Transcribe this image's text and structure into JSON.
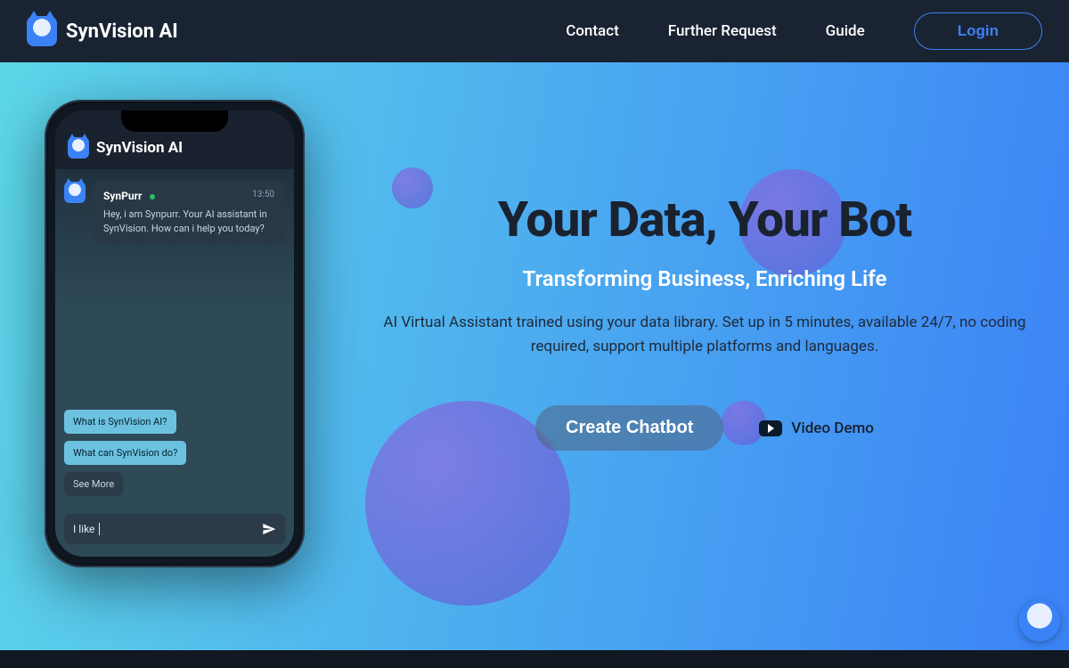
{
  "brand": {
    "name": "SynVision AI"
  },
  "nav": {
    "links": [
      "Contact",
      "Further Request",
      "Guide"
    ],
    "login": "Login"
  },
  "hero": {
    "headline": "Your Data, Your Bot",
    "subhead": "Transforming Business, Enriching Life",
    "body": "AI Virtual Assistant trained using your data library. Set up in 5 minutes, available 24/7, no coding required, support multiple platforms and languages.",
    "cta_primary": "Create Chatbot",
    "cta_secondary": "Video Demo"
  },
  "phone": {
    "app_title": "SynVision AI",
    "bot_name": "SynPurr",
    "time": "13:50",
    "greeting": "Hey, i am Synpurr. Your AI assistant in SynVision. How can i help you today?",
    "suggestions": [
      "What is SynVision AI?",
      "What can SynVision do?"
    ],
    "see_more": "See More",
    "input_value": "I like "
  }
}
